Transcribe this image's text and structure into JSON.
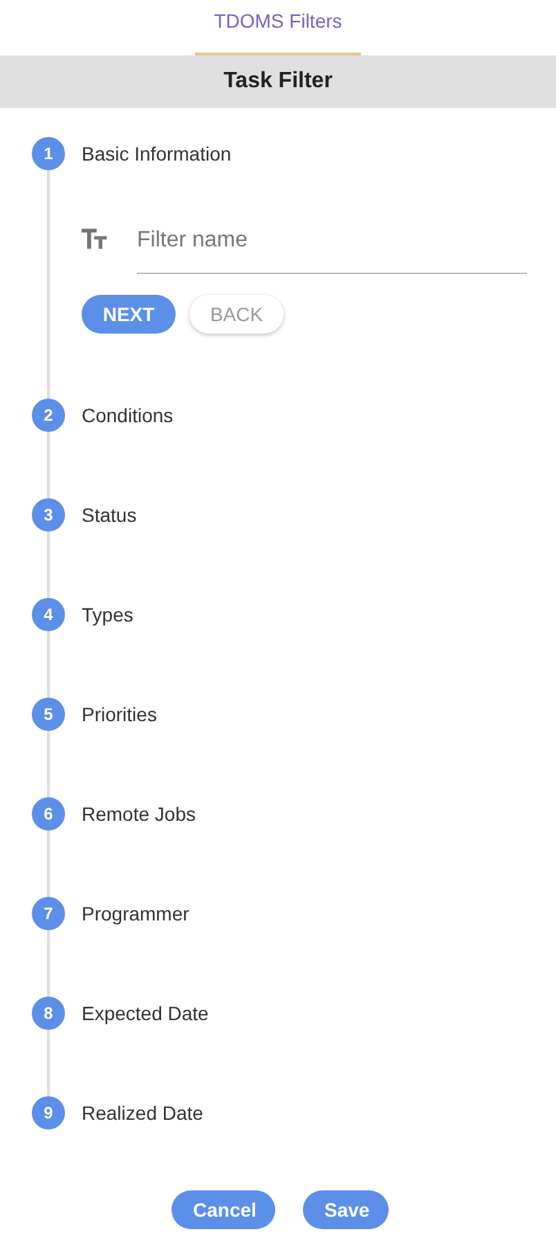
{
  "tabs": [
    {
      "label": "TDOMS Filters",
      "selected": true
    }
  ],
  "header": {
    "title": "Task Filter"
  },
  "steps": [
    {
      "number": "1",
      "label": "Basic Information",
      "expanded": true,
      "field": {
        "placeholder": "Filter name"
      },
      "buttons": [
        {
          "label": "NEXT",
          "kind": "primary"
        },
        {
          "label": "BACK",
          "kind": "secondary"
        }
      ]
    },
    {
      "number": "2",
      "label": "Conditions",
      "expanded": false
    },
    {
      "number": "3",
      "label": "Status",
      "expanded": false
    },
    {
      "number": "4",
      "label": "Types",
      "expanded": false
    },
    {
      "number": "5",
      "label": "Priorities",
      "expanded": false
    },
    {
      "number": "6",
      "label": "Remote Jobs",
      "expanded": false
    },
    {
      "number": "7",
      "label": "Programmer",
      "expanded": false
    },
    {
      "number": "8",
      "label": "Expected Date",
      "expanded": false
    },
    {
      "number": "9",
      "label": "Realized Date",
      "expanded": false
    }
  ],
  "footer_buttons": [
    "Cancel",
    "Save"
  ]
}
